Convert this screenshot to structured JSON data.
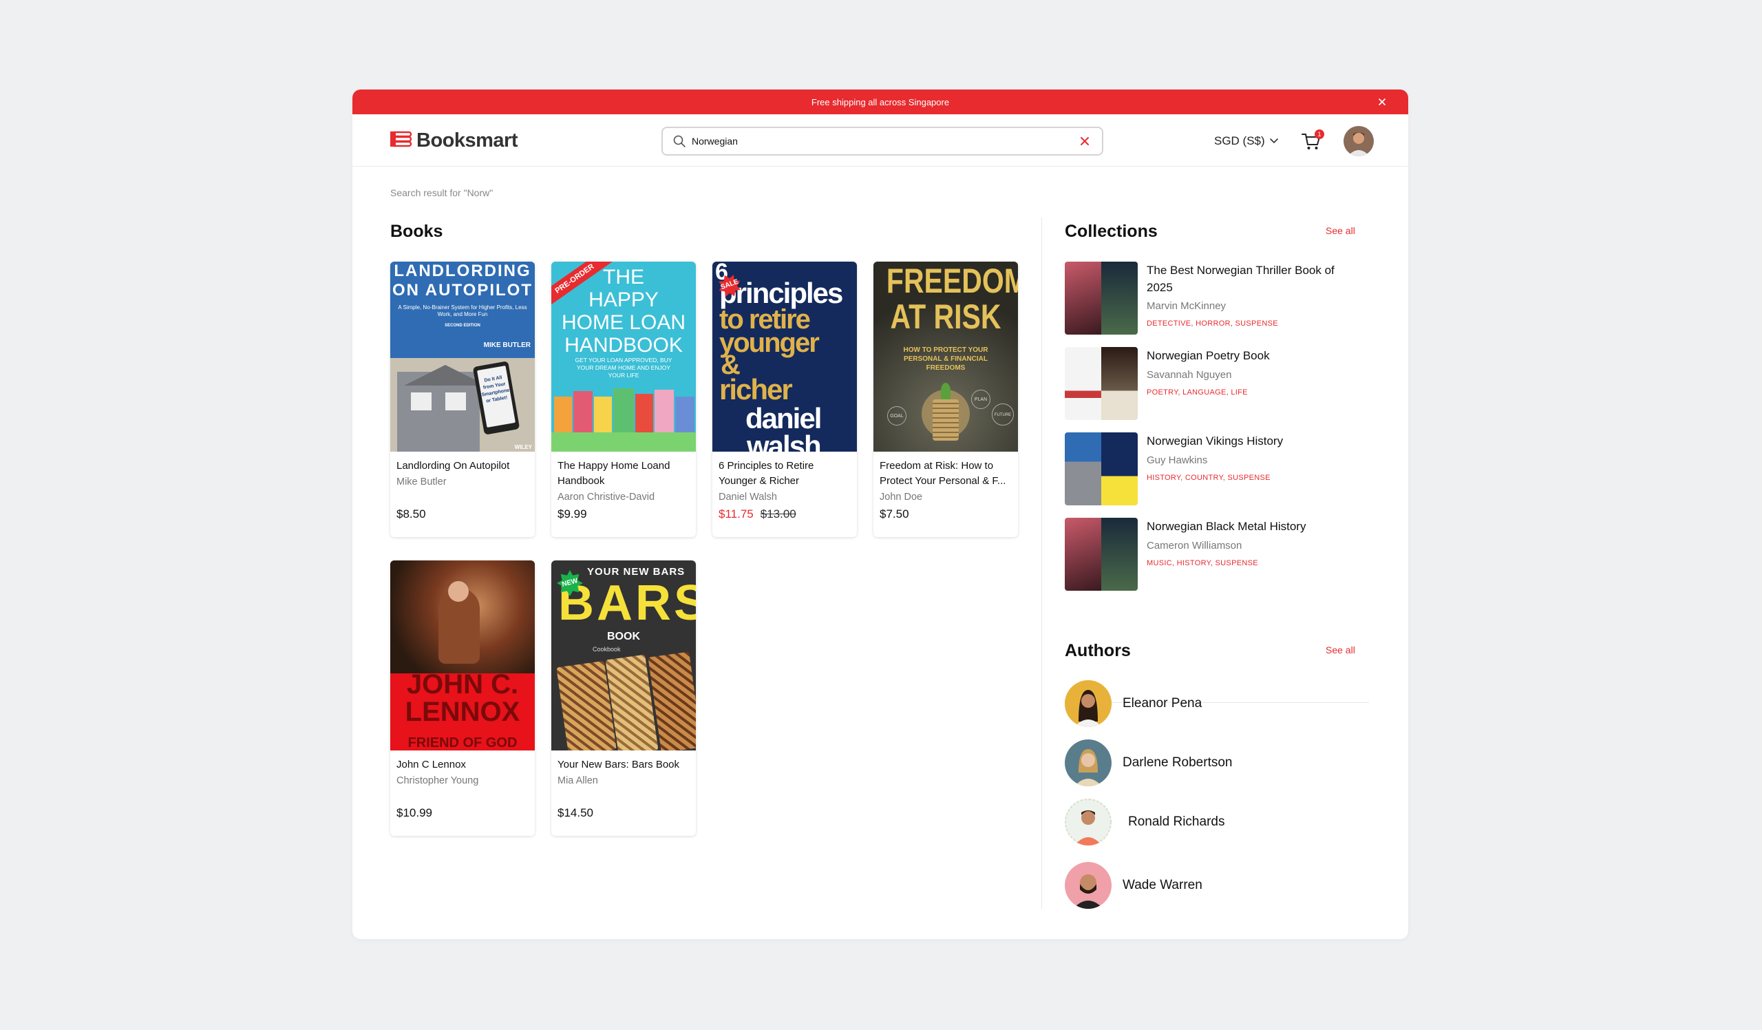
{
  "banner": {
    "text": "Free shipping all across Singapore",
    "close_icon": "close-icon"
  },
  "header": {
    "logo_text": "Booksmart",
    "search_value": "Norwegian",
    "currency": "SGD (S$)",
    "cart_count": "1",
    "icons": [
      "logo-icon",
      "search-icon",
      "clear-icon",
      "chevron-down-icon",
      "cart-icon"
    ]
  },
  "results": {
    "text": "Search result for \"Norw\""
  },
  "books": {
    "title": "Books",
    "items": [
      {
        "title": "Landlording On Autopilot",
        "author": "Mike Butler",
        "price": "$8.50",
        "cover_lines": [
          "LANDLORDING",
          "ON AUTOPILOT",
          "A Simple, No-Brainer System for Higher Profits, Less Work, and More Fun",
          "SECOND EDITION",
          "MIKE BUTLER",
          "Do It All from Your Smartphone or Tablet!",
          "WILEY"
        ],
        "cover_color": "#3a6ea5"
      },
      {
        "title": "The Happy Home Loand Handbook",
        "author": "Aaron Christive-David",
        "price": "$9.99",
        "badge": "PRE-ORDER",
        "cover_lines": [
          "THE",
          "HAPPY",
          "HOME LOAN",
          "HANDBOOK",
          "GET YOUR LOAN APPROVED, BUY YOUR DREAM HOME AND ENJOY YOUR LIFE"
        ],
        "cover_color": "#3bbfd6"
      },
      {
        "title": "6 Principles to Retire Younger & Richer",
        "author": "Daniel Walsh",
        "price": "$11.75",
        "old_price": "$13.00",
        "badge": "SALE",
        "cover_lines": [
          "6",
          "principles",
          "to retire",
          "younger",
          "&",
          "richer",
          "daniel",
          "walsh"
        ],
        "cover_color": "#142a5c"
      },
      {
        "title": "Freedom at Risk: How to Protect Your Personal & F...",
        "author": "John Doe",
        "price": "$7.50",
        "cover_lines": [
          "FREEDOM",
          "AT RISK",
          "HOW TO PROTECT YOUR PERSONAL & FINANCIAL FREEDOMS",
          "GOAL",
          "PLAN",
          "FUTURE"
        ],
        "cover_color": "#2b2b24"
      },
      {
        "title": "John C Lennox",
        "author": "Christopher Young",
        "price": "$10.99",
        "cover_lines": [
          "JOHN C.",
          "LENNOX",
          "FRIEND OF GOD"
        ],
        "cover_color": "#5b2a1a"
      },
      {
        "title": "Your New Bars: Bars Book",
        "author": "Mia Allen",
        "price": "$14.50",
        "badge": "NEW",
        "cover_lines": [
          "YOUR NEW BARS",
          "BARS",
          "BOOK",
          "Cookbook"
        ],
        "cover_color": "#333333"
      }
    ]
  },
  "collections": {
    "title": "Collections",
    "see_all": "See all",
    "items": [
      {
        "title": "The Best Norwegian Thriller Book of 2025",
        "author": "Marvin McKinney",
        "tags": "DETECTIVE, HORROR, SUSPENSE",
        "thumb_colors": [
          "#b03a48",
          "#2f4a3a"
        ]
      },
      {
        "title": "Norwegian Poetry Book",
        "author": "Savannah Nguyen",
        "tags": "POETRY, LANGUAGE, LIFE",
        "thumb_colors": [
          "#ededed",
          "#5a3a2a"
        ]
      },
      {
        "title": "Norwegian Vikings History",
        "author": "Guy Hawkins",
        "tags": "HISTORY, COUNTRY, SUSPENSE",
        "thumb_colors": [
          "#3a6ea5",
          "#142a5c"
        ]
      },
      {
        "title": "Norwegian Black Metal History",
        "author": "Cameron Williamson",
        "tags": "MUSIC, HISTORY, SUSPENSE",
        "thumb_colors": [
          "#b03a48",
          "#2f4a3a"
        ]
      }
    ]
  },
  "authors": {
    "title": "Authors",
    "see_all": "See all",
    "items": [
      {
        "name": "Eleanor Pena",
        "bg": "#e8b23a"
      },
      {
        "name": "Darlene Robertson",
        "bg": "#5a7d8c"
      },
      {
        "name": "Ronald Richards",
        "bg": "#e9efe6"
      },
      {
        "name": "Wade Warren",
        "bg": "#f0a0a8"
      }
    ]
  },
  "colors": {
    "accent": "#e72b2f",
    "text": "#111111",
    "muted": "#777777"
  }
}
